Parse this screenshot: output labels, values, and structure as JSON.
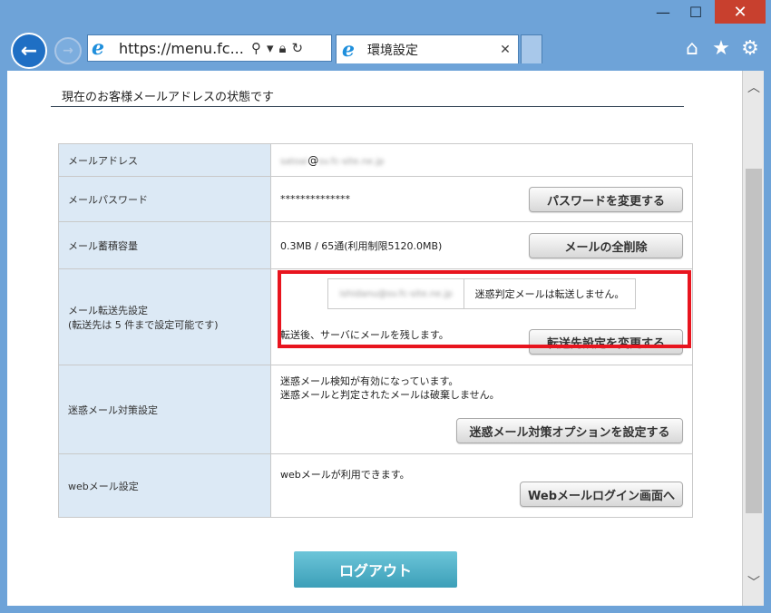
{
  "browser": {
    "address": "https://menu.fc...",
    "tab_title": "環境設定",
    "tab_close": "✕",
    "win_min": "—",
    "win_max": "☐",
    "win_close": "✕"
  },
  "page": {
    "heading": "現在のお客様メールアドレスの状態です",
    "rows": {
      "email": {
        "label": "メールアドレス",
        "value_prefix": "satoai",
        "at": "@",
        "value_suffix": "sv.fc-site.ne.jp"
      },
      "password": {
        "label": "メールパスワード",
        "value": "**************",
        "button": "パスワードを変更する"
      },
      "storage": {
        "label": "メール蓄積容量",
        "value": "0.3MB / 65通(利用制限5120.0MB)",
        "button": "メールの全削除"
      },
      "forward": {
        "label_line1": "メール転送先設定",
        "label_line2": "(転送先は 5 件まで設定可能です)",
        "forward_address": "ishidanu@sv.fc-site.ne.jp",
        "forward_note": "迷惑判定メールは転送しません。",
        "keep_note": "転送後、サーバにメールを残します。",
        "button": "転送先設定を変更する"
      },
      "spam": {
        "label": "迷惑メール対策設定",
        "text_line1": "迷惑メール検知が有効になっています。",
        "text_line2": "迷惑メールと判定されたメールは破棄しません。",
        "button": "迷惑メール対策オプションを設定する"
      },
      "webmail": {
        "label": "webメール設定",
        "text": "webメールが利用できます。",
        "button": "Webメールログイン画面へ"
      }
    },
    "logout": "ログアウト"
  },
  "colors": {
    "frame": "#6ea3d8",
    "label_bg": "#dce9f5",
    "highlight": "#e8141e",
    "logout_bg": "#4aafc6",
    "close_btn": "#c8402e"
  },
  "icons": {
    "back": "arrow-left-icon",
    "forward": "arrow-right-icon",
    "search": "search-icon",
    "lock": "lock-icon",
    "refresh": "refresh-icon",
    "home": "home-icon",
    "favorites": "star-icon",
    "settings": "gear-icon"
  }
}
